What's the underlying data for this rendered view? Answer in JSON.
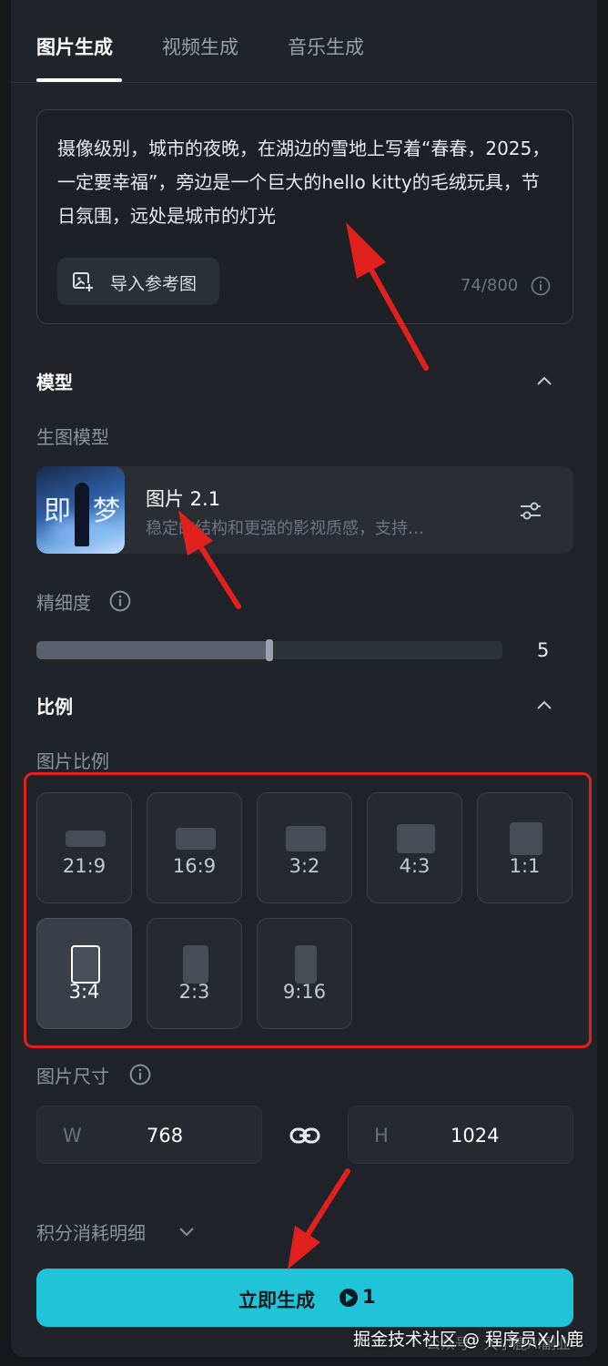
{
  "tabs": [
    {
      "label": "图片生成",
      "active": true
    },
    {
      "label": "视频生成",
      "active": false
    },
    {
      "label": "音乐生成",
      "active": false
    }
  ],
  "prompt": {
    "text": "摄像级别，城市的夜晚，在湖边的雪地上写着“春春，2025，一定要幸福”，旁边是一个巨大的hello kitty的毛绒玩具，节日氛围，远处是城市的灯光",
    "import_label": "导入参考图",
    "counter": "74/800"
  },
  "model_section": {
    "title": "模型",
    "sub_label": "生图模型",
    "model_name": "图片 2.1",
    "model_desc": "稳定的结构和更强的影视质感，支持…",
    "thumb_text_1": "即",
    "thumb_text_2": "梦",
    "detail_label": "精细度",
    "detail_value": "5",
    "detail_fraction": 0.5
  },
  "ratio_section": {
    "title": "比例",
    "sub_label": "图片比例",
    "ratios": [
      "21:9",
      "16:9",
      "3:2",
      "4:3",
      "1:1",
      "3:4",
      "2:3",
      "9:16"
    ],
    "selected": "3:4"
  },
  "size_section": {
    "label": "图片尺寸",
    "w_key": "W",
    "w_value": "768",
    "h_key": "H",
    "h_value": "1024"
  },
  "cost_label": "积分消耗明细",
  "generate": {
    "label": "立即生成",
    "credits": "1",
    "color": "#1fc4d8"
  },
  "watermark": {
    "text": "掘金技术社区 @ 程序员X小鹿",
    "faint": "公众号 · 大小鹿AI副业"
  },
  "annotation_color": "#e0211d"
}
